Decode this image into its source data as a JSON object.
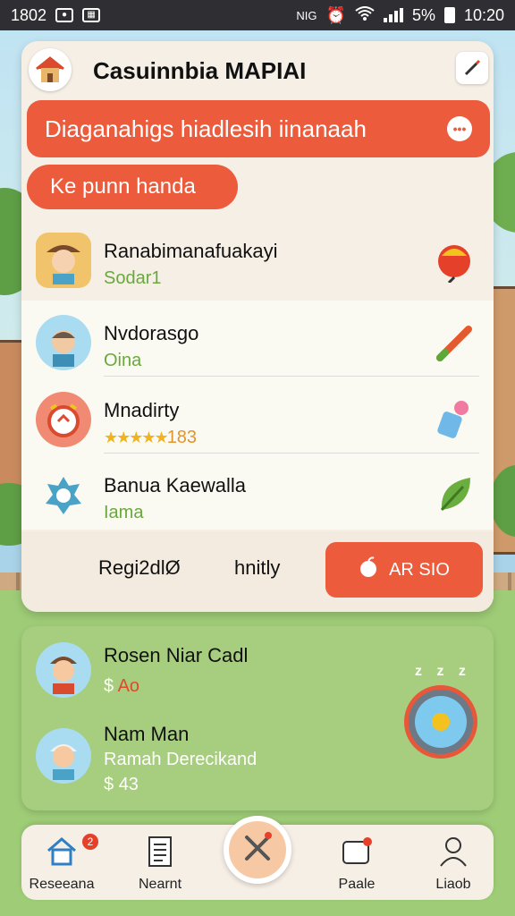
{
  "status_bar": {
    "time_left": "1802",
    "right_label": "NIG",
    "battery": "5%",
    "time": "10:20"
  },
  "header": {
    "title": "Casuinnbia MAPIAI"
  },
  "banner": {
    "text": "Diaganahigs hiadlesih iinanaah"
  },
  "pill": {
    "text": "Ke punn handa"
  },
  "contacts": [
    {
      "name": "Ranabimanafuakayi",
      "sub": "Sodar1"
    },
    {
      "name": "Nvdorasgo",
      "sub": "Oina"
    },
    {
      "name": "Mnadirty",
      "stars": "★★★★★",
      "rating": "183"
    },
    {
      "name": "Banua Kaewalla",
      "sub": "Iama"
    }
  ],
  "footer": {
    "label1": "Regi2dlØ",
    "label2": "hnitly",
    "cta": "AR SIO"
  },
  "offers": [
    {
      "name": "Rosen Niar Cadl",
      "currency": "$",
      "price": "Ao"
    },
    {
      "name": "Nam Man",
      "location": "Ramah Derecikand",
      "currency": "$",
      "price": "43"
    }
  ],
  "offers_zz": "z z z",
  "bottom_nav": {
    "items": [
      {
        "label": "Reseeana",
        "badge": "2"
      },
      {
        "label": "Nearnt"
      },
      {
        "label": "Paale"
      },
      {
        "label": "Liaob"
      }
    ]
  },
  "colors": {
    "accent": "#eb5b3c",
    "green": "#6aa83f",
    "card": "#f6efe6",
    "offer_card": "#a7cd7e"
  },
  "icons": [
    "home-icon",
    "edit-icon",
    "chat-icon",
    "bell-icon",
    "flute-icon",
    "cup-icon",
    "leaf-icon",
    "apple-icon",
    "clock-icon",
    "document-icon",
    "close-icon",
    "calendar-icon",
    "user-icon"
  ]
}
